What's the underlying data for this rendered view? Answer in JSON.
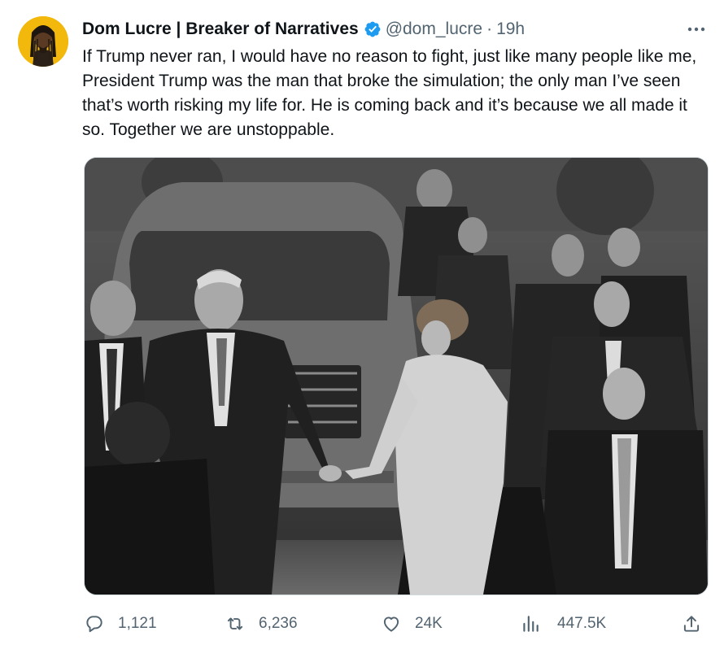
{
  "tweet": {
    "display_name": "Dom Lucre | Breaker of Narratives",
    "handle": "@dom_lucre",
    "separator": "·",
    "time": "19h",
    "text": "If Trump never ran, I would have no reason to fight, just like many people like me, President Trump was the man that broke the simulation; the only man I’ve seen that’s worth risking my life for. He is coming back and it’s because we all made it so. Together we are unstoppable.",
    "media_icon": "photo",
    "colors": {
      "verified": "#1d9bf0",
      "secondary": "#536471",
      "avatar_bg": "#f2b80b"
    }
  },
  "actions": {
    "replies": {
      "icon": "reply-icon",
      "count": "1,121"
    },
    "retweets": {
      "icon": "retweet-icon",
      "count": "6,236"
    },
    "likes": {
      "icon": "heart-icon",
      "count": "24K"
    },
    "views": {
      "icon": "views-chart-icon",
      "count": "447.5K"
    },
    "share": {
      "icon": "share-upload-icon"
    }
  }
}
